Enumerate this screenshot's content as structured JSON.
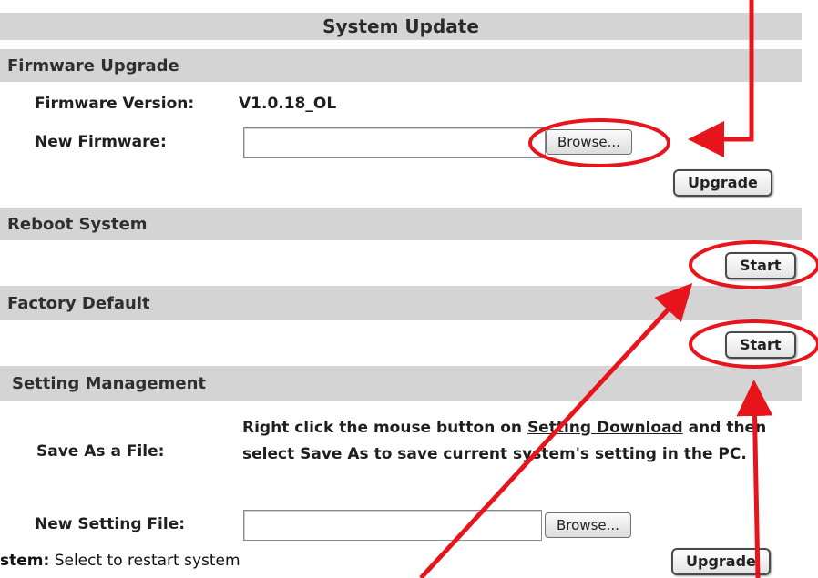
{
  "page_title": "System Update",
  "firmware_upgrade": {
    "heading": "Firmware Upgrade",
    "version_label": "Firmware Version:",
    "version_value": "V1.0.18_OL",
    "new_firmware_label": "New Firmware:",
    "file_value": "",
    "browse_label": "Browse...",
    "upgrade_label": "Upgrade"
  },
  "reboot_system": {
    "heading": "Reboot System",
    "start_label": "Start"
  },
  "factory_default": {
    "heading": "Factory Default",
    "start_label": "Start"
  },
  "setting_management": {
    "heading": "Setting Management",
    "save_as_label": "Save As a File:",
    "desc_before": "Right click the mouse button on ",
    "desc_link": "Setting Download",
    "desc_after": " and then select Save As to save current system's setting in the PC.",
    "new_setting_label": "New Setting File:",
    "file_value": "",
    "browse_label": "Browse...",
    "upgrade_label": "Upgrade"
  },
  "caption": {
    "bold": "stem:",
    "text": " Select to restart system"
  },
  "annotation_color": "#e8141c"
}
